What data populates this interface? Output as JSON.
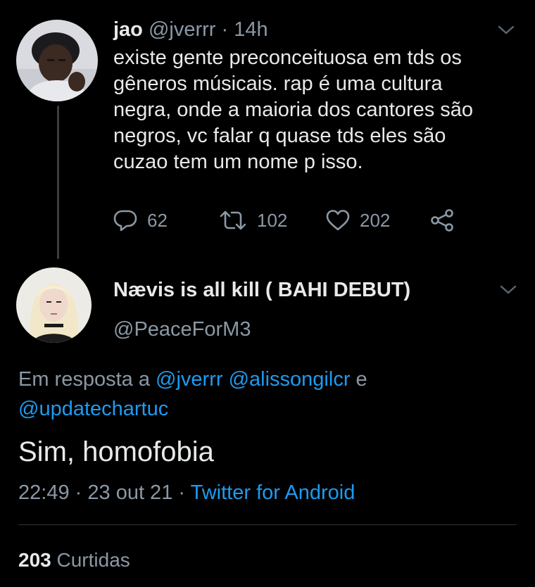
{
  "colors": {
    "background": "#000000",
    "text": "#e7e9ea",
    "muted": "#8b98a5",
    "link": "#1d9bf0",
    "divider": "#2f3336"
  },
  "tweet1": {
    "display_name": "jao",
    "handle": "@jverrr",
    "separator": "·",
    "time": "14h",
    "lines": [
      "existe gente preconceituosa em tds os",
      "gêneros músicais. rap é uma cultura",
      "negra, onde a maioria dos cantores são",
      "negros, vc falar q quase tds eles são",
      "cuzao tem um nome p isso."
    ],
    "reply_count": "62",
    "retweet_count": "102",
    "like_count": "202",
    "icons": [
      "reply-icon",
      "retweet-icon",
      "like-icon",
      "share-icon",
      "chevron-down-icon"
    ]
  },
  "tweet2": {
    "display_name": "Nævis is all kill ( BAHI DEBUT)",
    "handle": "@PeaceForM3",
    "reply_prefix": "Em resposta a",
    "mention_1": "@jverrr",
    "mention_2": "@alissongilcr",
    "reply_and": "e",
    "mention_3": "@updatechartuc",
    "text": "Sim, homofobia",
    "time": "22:49",
    "separator": "·",
    "date": "23 out 21",
    "source": "Twitter for Android",
    "likes_count": "203",
    "likes_label": "Curtidas"
  }
}
